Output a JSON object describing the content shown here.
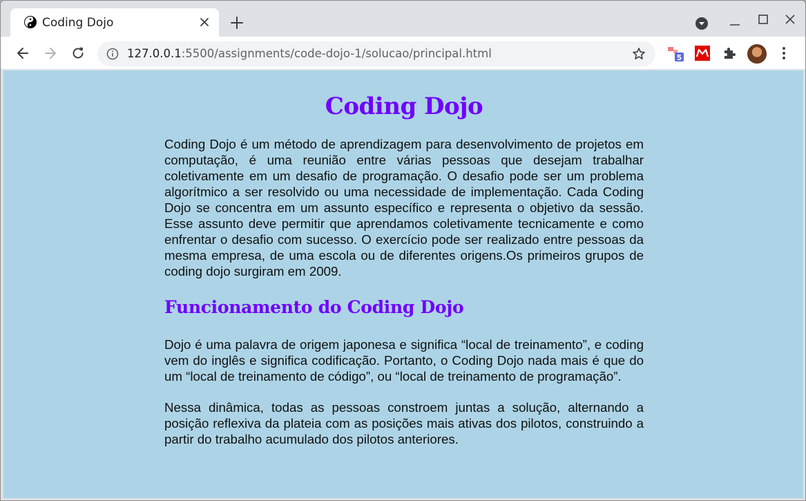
{
  "browser": {
    "tab_title": "Coding Dojo",
    "url_host": "127.0.0.1",
    "url_path": ":5500/assignments/code-dojo-1/solucao/principal.html",
    "extension_badge": "5"
  },
  "page": {
    "title": "Coding Dojo",
    "intro": "Coding Dojo é um método de aprendizagem para desenvolvimento de projetos em computação, é uma reunião entre várias pessoas que desejam trabalhar coletivamente em um desafio de programação. O desafio pode ser um problema algorítmico a ser resolvido ou uma necessidade de implementação. Cada Coding Dojo se concentra em um assunto específico e representa o objetivo da sessão. Esse assunto deve permitir que aprendamos coletivamente tecnicamente e como enfrentar o desafio com sucesso. O exercício pode ser realizado entre pessoas da mesma empresa, de uma escola ou de diferentes origens.Os primeiros grupos de coding dojo surgiram em 2009.",
    "section_heading": "Funcionamento do Coding Dojo",
    "paragraph_2": "Dojo é uma palavra de origem japonesa e significa “local de treinamento”, e coding vem do inglês e significa codificação. Portanto, o Coding Dojo nada mais é que do um “local de treinamento de código”, ou “local de treinamento de programação”.",
    "paragraph_3": "Nessa dinâmica, todas as pessoas constroem juntas a solução, alternando a posição reflexiva da plateia com as posições mais ativas dos pilotos, construindo a partir do trabalho acumulado dos pilotos anteriores."
  },
  "colors": {
    "page_background": "#add4e6",
    "heading": "#7000ff",
    "text": "#111111"
  }
}
